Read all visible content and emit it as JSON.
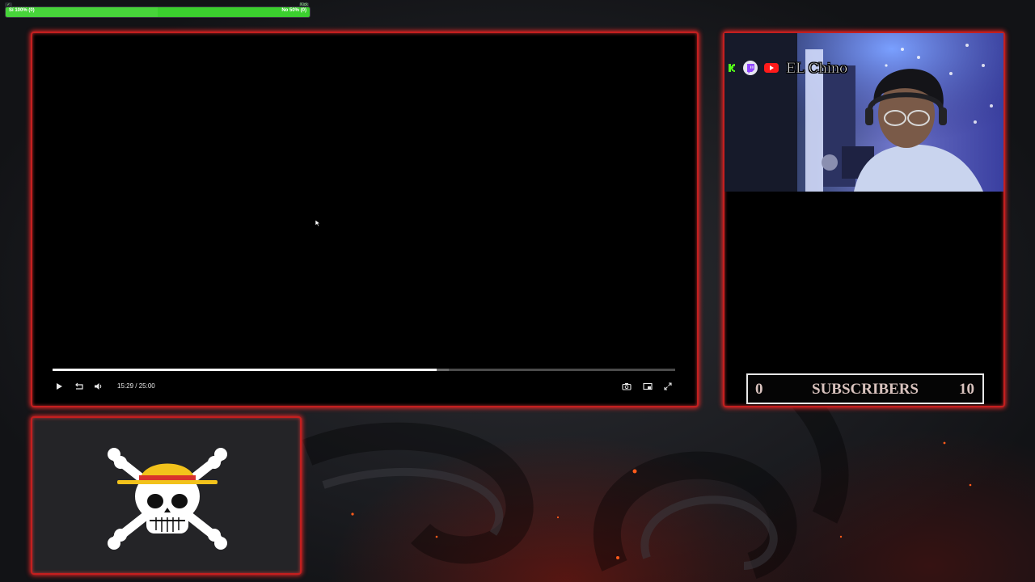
{
  "poll": {
    "yes_label": "Sí 100% (0)",
    "no_label": "No 50% (0)",
    "yes_icon": "check-icon",
    "no_icon": "kick-icon",
    "no_icon_text": "Kick",
    "colors": {
      "fill": "#47d43a"
    }
  },
  "player": {
    "current_time": "15:29",
    "separator": "/",
    "duration": "25:00",
    "progress": 0.617,
    "buffered": 0.637,
    "controls": [
      "play-icon",
      "replay-icon",
      "volume-icon",
      "screenshot-icon",
      "pip-icon",
      "fullscreen-icon"
    ]
  },
  "webcam": {
    "handle": "EL Chino",
    "socials": [
      "kick-icon",
      "twitch-icon",
      "youtube-icon"
    ]
  },
  "subscribers": {
    "current": "0",
    "label": "SUBSCRIBERS",
    "goal": "10"
  },
  "theme": {
    "frame_color": "#c41f1f",
    "accent_yellow": "#f2c21b",
    "accent_red": "#d9322b"
  }
}
